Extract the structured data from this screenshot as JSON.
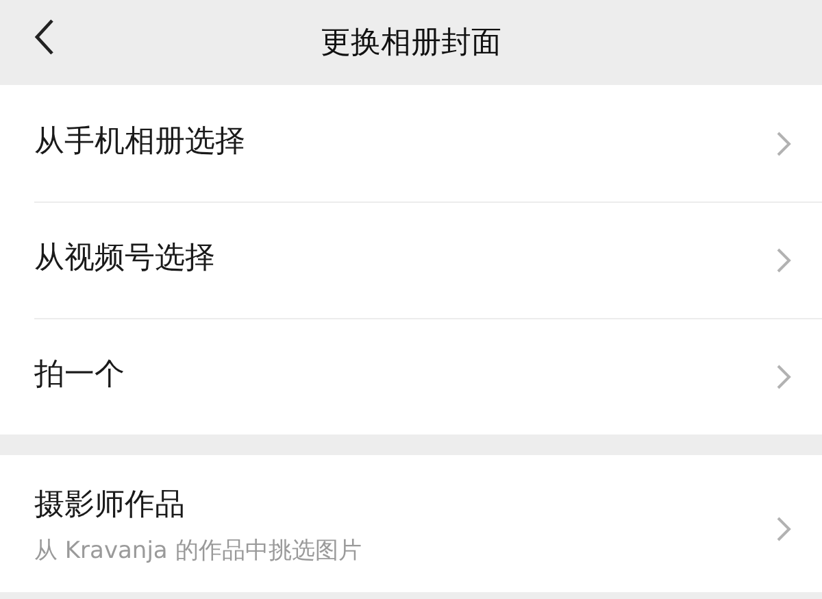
{
  "nav_bar": {
    "title": "更换相册封面"
  },
  "groups": [
    {
      "items": [
        {
          "title": "从手机相册选择"
        },
        {
          "title": "从视频号选择"
        },
        {
          "title": "拍一个"
        }
      ]
    },
    {
      "items": [
        {
          "title": "摄影师作品",
          "subtitle": "从 Kravanja 的作品中挑选图片"
        }
      ]
    }
  ]
}
